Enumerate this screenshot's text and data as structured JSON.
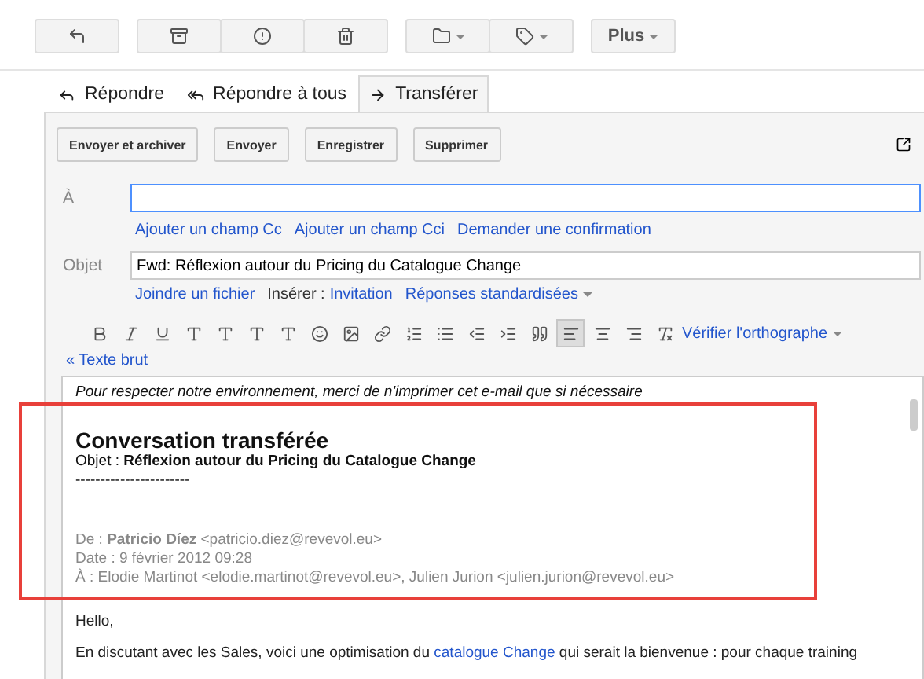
{
  "toolbar": {
    "more_button": "Plus"
  },
  "tabs": [
    {
      "label": "Répondre",
      "selected": false
    },
    {
      "label": "Répondre à tous",
      "selected": false
    },
    {
      "label": "Transférer",
      "selected": true
    }
  ],
  "actions": [
    "Envoyer et archiver",
    "Envoyer",
    "Enregistrer",
    "Supprimer"
  ],
  "to": {
    "label": "À"
  },
  "to_links": [
    "Ajouter un champ Cc",
    "Ajouter un champ Cci",
    "Demander une confirmation"
  ],
  "subject": {
    "label": "Objet",
    "value": "Fwd: Réflexion autour du Pricing du Catalogue Change"
  },
  "attach_link": "Joindre un fichier",
  "insert_label": "Insérer :",
  "insert_link": "Invitation",
  "canned_link": "Réponses standardisées",
  "alignment": [
    {
      "selected": true
    },
    {
      "selected": false
    },
    {
      "selected": false
    }
  ],
  "spellcheck": "Vérifier l'orthographe",
  "plain_text": "« Texte brut",
  "body": {
    "notice": "Pour respecter notre environnement, merci de n'imprimer cet e-mail que si nécessaire",
    "forwarded": {
      "title": "Conversation transférée",
      "subject_label": "Objet :",
      "subject": "Réflexion autour du Pricing du Catalogue Change",
      "separator": "-----------------------",
      "from_label": "De :",
      "from_name": "Patricio Díez",
      "from_email": "<patricio.diez@revevol.eu>",
      "date": "Date : 9 février 2012 09:28",
      "to": "À : Elodie Martinot <elodie.martinot@revevol.eu>, Julien Jurion <julien.jurion@revevol.eu>"
    },
    "greeting": "Hello,",
    "paragraph": {
      "before": "En discutant avec les Sales, voici une optimisation du",
      "link": "catalogue Change",
      "after": "qui serait la bienvenue : pour chaque training"
    }
  }
}
